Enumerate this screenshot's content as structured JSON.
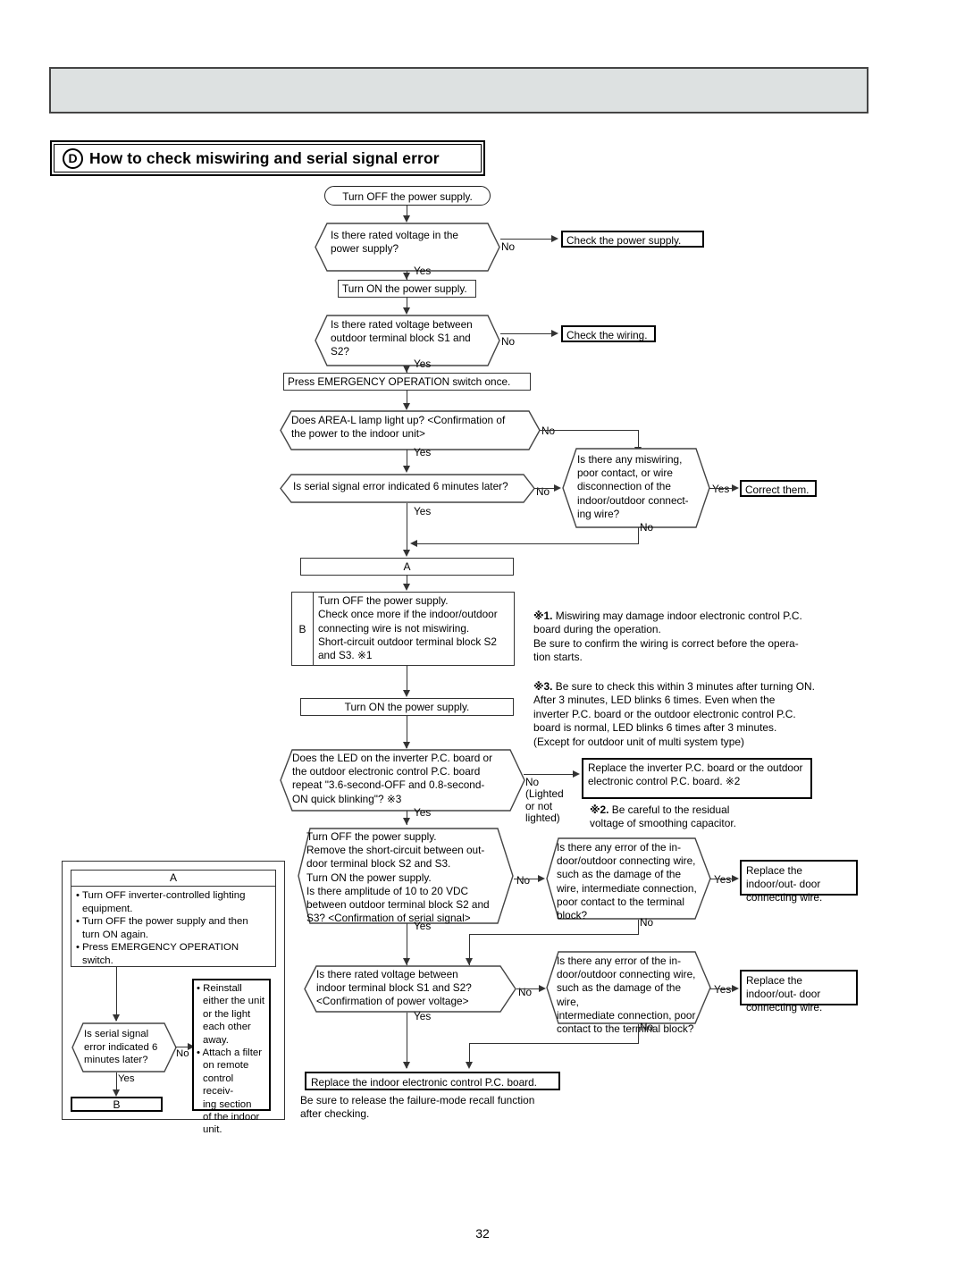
{
  "page": {
    "number": "32",
    "header_bar": "",
    "section": {
      "badge": "D",
      "title": "How to check miswiring and serial signal error"
    }
  },
  "flow": {
    "n1_turn_off": "Turn OFF the power supply.",
    "n2_rated_v": "Is there rated voltage in the\npower supply?",
    "n2_no": "No",
    "n2_yes": "Yes",
    "n3_check_ps": "Check the power supply.",
    "n4_turn_on": "Turn ON the power supply.",
    "n5_rated_s1s2": "Is there rated voltage between\noutdoor terminal block S1 and\nS2?",
    "n5_no": "No",
    "n5_yes": "Yes",
    "n6_check_wiring": "Check the wiring.",
    "n7_press_emg": "Press EMERGENCY OPERATION switch once.",
    "n8_area_l": "Does AREA-L lamp light up? <Confirmation of\nthe power to the indoor unit>",
    "n8_no": "No",
    "n8_yes": "Yes",
    "n9_serial6": "Is serial signal error indicated 6 minutes later?",
    "n9_no": "No",
    "n9_yes": "Yes",
    "n10_miswiring": "Is there any miswiring,\npoor contact, or wire\ndisconnection of the\nindoor/outdoor connect-\ning wire?",
    "n10_yes": "Yes",
    "n10_no": "No",
    "n11_correct": "Correct them.",
    "bar_a": "A",
    "b_tag": "B",
    "b_body": "Turn OFF the power supply.\nCheck once more if the indoor/outdoor\nconnecting wire is not miswiring.\nShort-circuit outdoor terminal block S2\nand S3. ※1",
    "n12_turn_on": "Turn ON the power supply.",
    "n13_led": "Does the LED on the inverter P.C. board or\nthe outdoor electronic control P.C. board\nrepeat \"3.6-second-OFF and 0.8-second-\nON quick blinking\"? ※3",
    "n13_no": "No\n(Lighted\nor not\nlighted)",
    "n13_yes": "Yes",
    "n14_replace_inv": "Replace the inverter P.C. board or the\noutdoor electronic control P.C. board.\n※2",
    "n15_amplitude": "Turn OFF the power supply.\nRemove the short-circuit between out-\ndoor terminal block S2 and S3.\nTurn ON the power supply.\nIs there amplitude of 10 to 20 VDC\nbetween outdoor terminal block S2 and\nS3?  <Confirmation of serial signal>",
    "n15_no": "No",
    "n15_yes": "Yes",
    "n16_error_wire": "Is there any error of the in-\ndoor/outdoor connecting wire,\nsuch as the damage of the\nwire, intermediate connection,\npoor contact to the terminal\nblock?",
    "n16_yes": "Yes",
    "n16_no": "No",
    "n17_replace_wire": "Replace the indoor/out-\ndoor connecting wire.",
    "n18_rated_indoor": "Is there rated voltage between\nindoor terminal block S1 and S2?\n<Confirmation of power voltage>",
    "n18_no": "No",
    "n18_yes": "Yes",
    "n19_error_wire2": "Is there any error of the in-\ndoor/outdoor connecting wire,\nsuch as the damage of the wire,\nintermediate connection, poor\ncontact to the terminal block?",
    "n19_yes": "Yes",
    "n19_no": "No",
    "n20_replace_wire2": "Replace the indoor/out-\ndoor connecting wire.",
    "n21_replace_indoor": "Replace the indoor electronic control P.C. board.",
    "n22_release": "Be sure to release the failure-mode recall function\nafter checking."
  },
  "notes": [
    {
      "num": "※1.",
      "text": "Miswiring may damage indoor electronic control P.C.\nboard during the operation.\nBe sure to confirm the wiring is correct before the opera-\ntion starts."
    },
    {
      "num": "※3.",
      "text": "Be sure to check this within 3 minutes after turning ON.\nAfter 3 minutes, LED blinks 6 times. Even when the\ninverter P.C. board or the outdoor electronic control P.C.\nboard is normal, LED blinks 6 times after 3 minutes.\n(Except for outdoor unit of multi system type)"
    }
  ],
  "note2": {
    "num": "※2.",
    "text": "Be careful to the residual\nvoltage of smoothing capacitor."
  },
  "left_panel": {
    "a_header": "A",
    "a_bullets": [
      "• Turn OFF inverter-controlled lighting\n   equipment.",
      "• Turn OFF the power supply and then\n   turn ON again.",
      "• Press EMERGENCY OPERATION\n   switch."
    ],
    "decision": "Is serial signal\nerror indicated 6\nminutes later?",
    "decision_no": "No",
    "decision_yes": "Yes",
    "bar_b": "B",
    "reinstall": [
      "• Reinstall\n  either the unit\n  or the light\n  each other\n  away.",
      "• Attach a filter\n  on remote\n  control receiv-\n  ing section\n  of the indoor\n  unit."
    ]
  }
}
